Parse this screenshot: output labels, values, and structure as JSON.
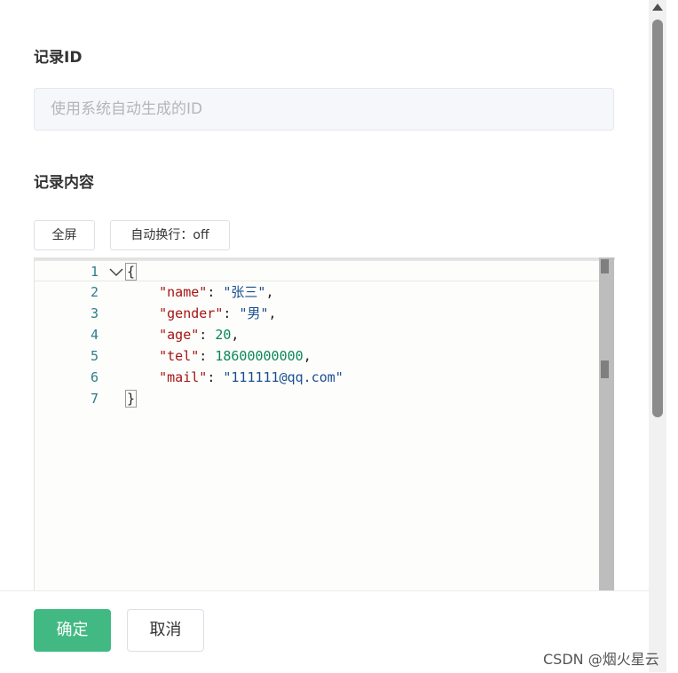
{
  "form": {
    "id_label": "记录ID",
    "id_placeholder": "使用系统自动生成的ID",
    "content_label": "记录内容"
  },
  "toolbar": {
    "fullscreen_label": "全屏",
    "wrap_label": "自动换行：off"
  },
  "editor": {
    "lines": [
      {
        "num": "1",
        "text": "{"
      },
      {
        "num": "2",
        "key": "\"name\"",
        "sep": ": ",
        "value": "\"张三\"",
        "tail": ","
      },
      {
        "num": "3",
        "key": "\"gender\"",
        "sep": ": ",
        "value": "\"男\"",
        "tail": ","
      },
      {
        "num": "4",
        "key": "\"age\"",
        "sep": ": ",
        "value": "20",
        "tail": ","
      },
      {
        "num": "5",
        "key": "\"tel\"",
        "sep": ": ",
        "value": "18600000000",
        "tail": ","
      },
      {
        "num": "6",
        "key": "\"mail\"",
        "sep": ": ",
        "value": "\"111111@qq.com\"",
        "tail": ""
      },
      {
        "num": "7",
        "text": "}"
      }
    ]
  },
  "footer": {
    "confirm_label": "确定",
    "cancel_label": "取消"
  },
  "watermark": "CSDN @烟火星云",
  "colors": {
    "primary": "#42b983",
    "json_key": "#a31515",
    "json_string": "#1b4f8f",
    "json_number": "#098658"
  },
  "icons": {
    "fold": "chevron-down-icon",
    "scroll_up": "triangle-up-icon"
  }
}
